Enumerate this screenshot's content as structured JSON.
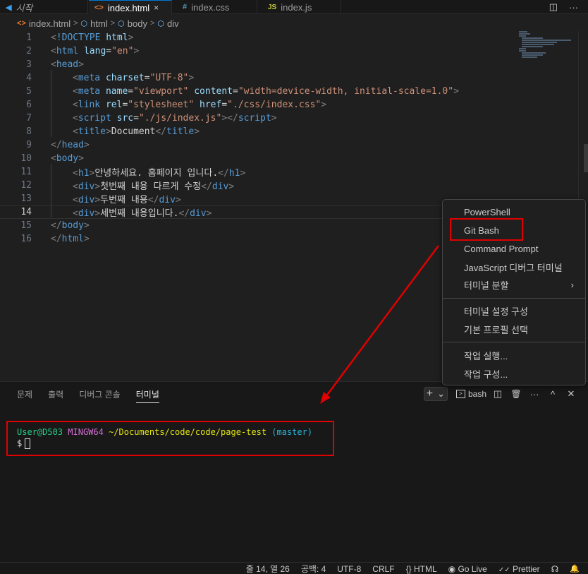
{
  "tabs": [
    {
      "icon": "vscode-icon",
      "label": "시작",
      "active": false
    },
    {
      "icon": "html-icon",
      "label": "index.html",
      "active": true
    },
    {
      "icon": "css-icon",
      "label": "index.css",
      "active": false
    },
    {
      "icon": "js-icon",
      "label": "index.js",
      "active": false
    }
  ],
  "tab_icon_glyphs": {
    "html": "<>",
    "css": "#",
    "js": "JS"
  },
  "breadcrumb": [
    "index.html",
    "html",
    "body",
    "div"
  ],
  "editor": {
    "active_line": 14,
    "lines": [
      {
        "n": "1",
        "indent": 0,
        "parts": [
          [
            "tg",
            "<"
          ],
          [
            "tn",
            "!DOCTYPE"
          ],
          [
            "tx",
            " "
          ],
          [
            "an",
            "html"
          ],
          [
            "tg",
            ">"
          ]
        ]
      },
      {
        "n": "2",
        "indent": 0,
        "parts": [
          [
            "tg",
            "<"
          ],
          [
            "tn",
            "html"
          ],
          [
            "tx",
            " "
          ],
          [
            "an",
            "lang"
          ],
          [
            "tx",
            "="
          ],
          [
            "av",
            "\"en\""
          ],
          [
            "tg",
            ">"
          ]
        ]
      },
      {
        "n": "3",
        "indent": 0,
        "parts": [
          [
            "tg",
            "<"
          ],
          [
            "tn",
            "head"
          ],
          [
            "tg",
            ">"
          ]
        ]
      },
      {
        "n": "4",
        "indent": 1,
        "parts": [
          [
            "tg",
            "<"
          ],
          [
            "tn",
            "meta"
          ],
          [
            "tx",
            " "
          ],
          [
            "an",
            "charset"
          ],
          [
            "tx",
            "="
          ],
          [
            "av",
            "\"UTF-8\""
          ],
          [
            "tg",
            ">"
          ]
        ]
      },
      {
        "n": "5",
        "indent": 1,
        "parts": [
          [
            "tg",
            "<"
          ],
          [
            "tn",
            "meta"
          ],
          [
            "tx",
            " "
          ],
          [
            "an",
            "name"
          ],
          [
            "tx",
            "="
          ],
          [
            "av",
            "\"viewport\""
          ],
          [
            "tx",
            " "
          ],
          [
            "an",
            "content"
          ],
          [
            "tx",
            "="
          ],
          [
            "av",
            "\"width=device-width, initial-scale=1.0\""
          ],
          [
            "tg",
            ">"
          ]
        ]
      },
      {
        "n": "6",
        "indent": 1,
        "parts": [
          [
            "tg",
            "<"
          ],
          [
            "tn",
            "link"
          ],
          [
            "tx",
            " "
          ],
          [
            "an",
            "rel"
          ],
          [
            "tx",
            "="
          ],
          [
            "av",
            "\"stylesheet\""
          ],
          [
            "tx",
            " "
          ],
          [
            "an",
            "href"
          ],
          [
            "tx",
            "="
          ],
          [
            "av",
            "\"./css/index.css\""
          ],
          [
            "tg",
            ">"
          ]
        ]
      },
      {
        "n": "7",
        "indent": 1,
        "parts": [
          [
            "tg",
            "<"
          ],
          [
            "tn",
            "script"
          ],
          [
            "tx",
            " "
          ],
          [
            "an",
            "src"
          ],
          [
            "tx",
            "="
          ],
          [
            "av",
            "\"./js/index.js\""
          ],
          [
            "tg",
            "></"
          ],
          [
            "tn",
            "script"
          ],
          [
            "tg",
            ">"
          ]
        ]
      },
      {
        "n": "8",
        "indent": 1,
        "parts": [
          [
            "tg",
            "<"
          ],
          [
            "tn",
            "title"
          ],
          [
            "tg",
            ">"
          ],
          [
            "tx",
            "Document"
          ],
          [
            "tg",
            "</"
          ],
          [
            "tn",
            "title"
          ],
          [
            "tg",
            ">"
          ]
        ]
      },
      {
        "n": "9",
        "indent": 0,
        "parts": [
          [
            "tg",
            "</"
          ],
          [
            "tn",
            "head"
          ],
          [
            "tg",
            ">"
          ]
        ]
      },
      {
        "n": "10",
        "indent": 0,
        "parts": [
          [
            "tg",
            "<"
          ],
          [
            "tn",
            "body"
          ],
          [
            "tg",
            ">"
          ]
        ]
      },
      {
        "n": "11",
        "indent": 1,
        "parts": [
          [
            "tg",
            "<"
          ],
          [
            "tn",
            "h1"
          ],
          [
            "tg",
            ">"
          ],
          [
            "tx",
            "안녕하세요. 홈페이지 입니다."
          ],
          [
            "tg",
            "</"
          ],
          [
            "tn",
            "h1"
          ],
          [
            "tg",
            ">"
          ]
        ]
      },
      {
        "n": "12",
        "indent": 1,
        "parts": [
          [
            "tg",
            "<"
          ],
          [
            "tn",
            "div"
          ],
          [
            "tg",
            ">"
          ],
          [
            "tx",
            "첫번째 내용 다르게 수정"
          ],
          [
            "tg",
            "</"
          ],
          [
            "tn",
            "div"
          ],
          [
            "tg",
            ">"
          ]
        ]
      },
      {
        "n": "13",
        "indent": 1,
        "parts": [
          [
            "tg",
            "<"
          ],
          [
            "tn",
            "div"
          ],
          [
            "tg",
            ">"
          ],
          [
            "tx",
            "두번째 내용"
          ],
          [
            "tg",
            "</"
          ],
          [
            "tn",
            "div"
          ],
          [
            "tg",
            ">"
          ]
        ]
      },
      {
        "n": "14",
        "indent": 1,
        "parts": [
          [
            "tg",
            "<"
          ],
          [
            "tn",
            "div"
          ],
          [
            "tg",
            ">"
          ],
          [
            "tx",
            "세번째 내용입니다."
          ],
          [
            "tg",
            "</"
          ],
          [
            "tn",
            "div"
          ],
          [
            "tg",
            ">"
          ]
        ]
      },
      {
        "n": "15",
        "indent": 0,
        "parts": [
          [
            "tg",
            "</"
          ],
          [
            "tn",
            "body"
          ],
          [
            "tg",
            ">"
          ]
        ]
      },
      {
        "n": "16",
        "indent": 0,
        "parts": [
          [
            "tg",
            "</"
          ],
          [
            "tn",
            "html"
          ],
          [
            "tg",
            ">"
          ]
        ]
      }
    ]
  },
  "panel": {
    "tabs": [
      "문제",
      "출력",
      "디버그 콘솔",
      "터미널"
    ],
    "active_tab": "터미널",
    "plus": "+",
    "chevron": "⌄",
    "terminal_name": "bash",
    "terminal_glyph": ">",
    "actions": [
      "split-icon",
      "trash-icon",
      "more-icon",
      "chevron-up-icon",
      "close-icon"
    ],
    "action_glyphs": [
      "◫",
      "🗑",
      "···",
      "^",
      "✕"
    ]
  },
  "terminal": {
    "user": "User@D503",
    "host": "MINGW64",
    "path": "~/Documents/code/code/page-test",
    "branch": "(master)",
    "prompt": "$"
  },
  "menu": {
    "items": [
      {
        "label": "PowerShell",
        "group": 1
      },
      {
        "label": "Git Bash",
        "group": 1,
        "highlighted": true
      },
      {
        "label": "Command Prompt",
        "group": 1
      },
      {
        "label": "JavaScript 디버그 터미널",
        "group": 1
      },
      {
        "label": "터미널 분할",
        "group": 1,
        "submenu": true
      },
      {
        "label": "터미널 설정 구성",
        "group": 2
      },
      {
        "label": "기본 프로필 선택",
        "group": 2
      },
      {
        "label": "작업 실행...",
        "group": 3
      },
      {
        "label": "작업 구성...",
        "group": 3
      }
    ],
    "submenu_glyph": "›"
  },
  "statusbar": {
    "items": [
      "줄 14, 열 26",
      "공백: 4",
      "UTF-8",
      "CRLF",
      "{} HTML",
      "Go Live",
      "Prettier"
    ],
    "icons": {
      "golive": "◉",
      "prettier": "✓✓",
      "feedback": "☊",
      "bell": "🔔"
    }
  },
  "tab_actions": [
    "◫",
    "···"
  ],
  "tab_close": "×",
  "annotation_color": "#e00000"
}
